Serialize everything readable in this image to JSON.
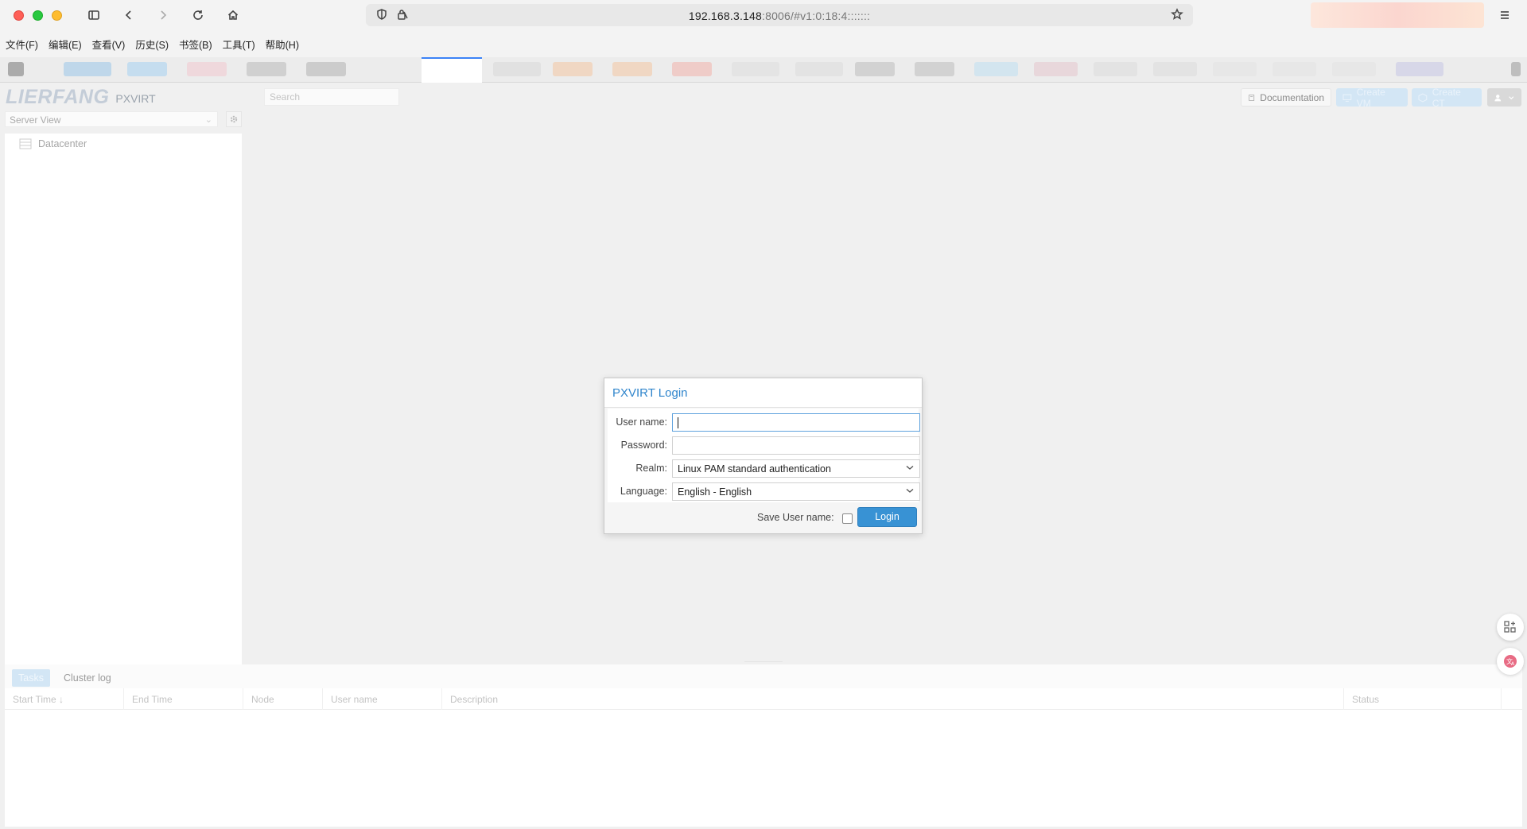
{
  "browser": {
    "url_host": "192.168.3.148",
    "url_rest": ":8006/#v1:0:18:4:::::::",
    "menu": [
      "文件(F)",
      "编辑(E)",
      "查看(V)",
      "历史(S)",
      "书签(B)",
      "工具(T)",
      "帮助(H)"
    ]
  },
  "header": {
    "logo_text": "LIERFANG",
    "product": "PXVIRT",
    "search_placeholder": "Search",
    "documentation": "Documentation",
    "create_vm": "Create VM",
    "create_ct": "Create CT"
  },
  "sidebar": {
    "view": "Server View",
    "tree_root": "Datacenter"
  },
  "login": {
    "title": "PXVIRT Login",
    "username_label": "User name:",
    "username_value": "",
    "password_label": "Password:",
    "realm_label": "Realm:",
    "realm_value": "Linux PAM standard authentication",
    "language_label": "Language:",
    "language_value": "English - English",
    "save_label": "Save User name:",
    "login_button": "Login"
  },
  "tasks": {
    "tabs": [
      "Tasks",
      "Cluster log"
    ],
    "columns": [
      "Start Time ↓",
      "End Time",
      "Node",
      "User name",
      "Description",
      "Status"
    ]
  },
  "colors": {
    "accent": "#3892d4",
    "title_blue": "#2f85cc",
    "background": "#f0f0f0"
  }
}
